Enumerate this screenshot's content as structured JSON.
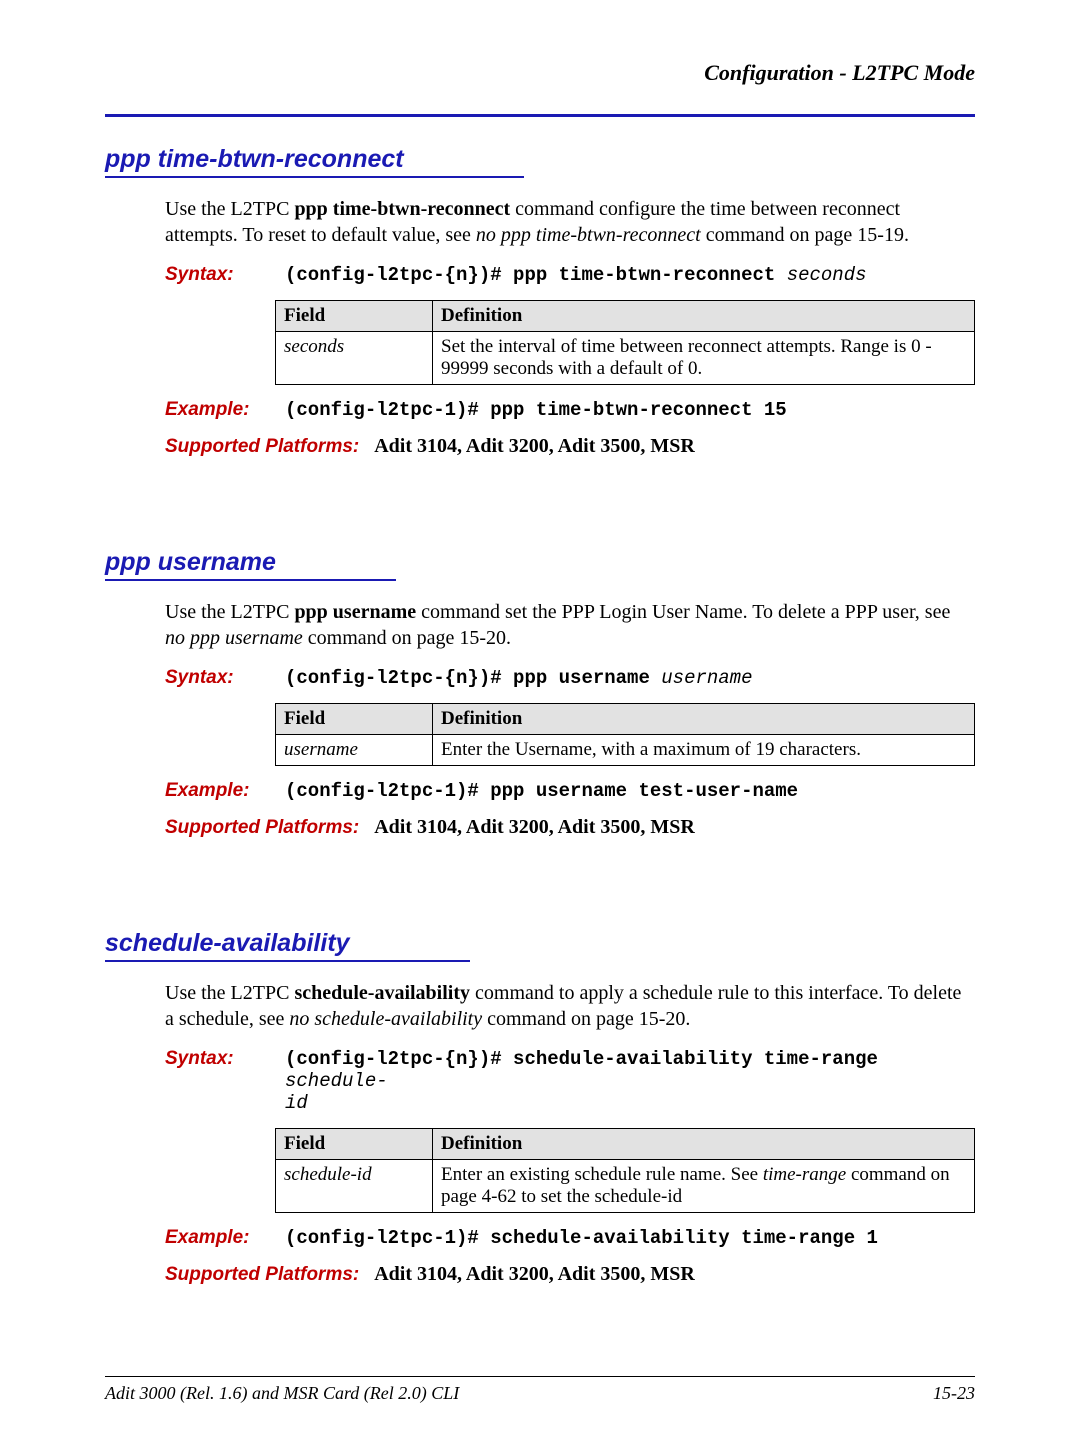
{
  "running_head": "Configuration - L2TPC Mode",
  "table_headers": {
    "field": "Field",
    "definition": "Definition"
  },
  "labels": {
    "syntax": "Syntax:",
    "example": "Example:",
    "platforms": "Supported Platforms:"
  },
  "sections": [
    {
      "title": "ppp time-btwn-reconnect",
      "intro_html": "Use the L2TPC <b>ppp time-btwn-reconnect</b> command configure the time between reconnect attempts. To reset to default value, see <i>no ppp time-btwn-reconnect</i> command on page 15-19.",
      "syntax_prefix": "(config-l2tpc-{n})# ppp time-btwn-reconnect ",
      "syntax_param": "seconds",
      "syntax_suffix": "",
      "table_row": {
        "field": "seconds",
        "definition_html": "Set the interval of time between reconnect attempts. Range is 0 - 99999 seconds with a default of 0."
      },
      "example": "(config-l2tpc-1)# ppp time-btwn-reconnect 15",
      "platforms": "Adit 3104, Adit 3200, Adit 3500, MSR"
    },
    {
      "title": "ppp username",
      "intro_html": "Use the L2TPC <b>ppp username</b> command set the PPP Login User Name. To delete a PPP user, see <i>no ppp username</i> command on page 15-20.",
      "syntax_prefix": "(config-l2tpc-{n})# ppp username ",
      "syntax_param": "username",
      "syntax_suffix": "",
      "table_row": {
        "field": "username",
        "definition_html": "Enter the Username, with a maximum of 19 characters."
      },
      "example": "(config-l2tpc-1)# ppp username test-user-name",
      "platforms": "Adit 3104, Adit 3200, Adit 3500, MSR"
    },
    {
      "title": "schedule-availability",
      "intro_html": "Use the L2TPC <b>schedule-availability</b> command to apply a schedule rule to this interface. To delete a schedule, see <i>no schedule-availability</i> command on page 15-20.",
      "syntax_prefix": "(config-l2tpc-{n})# schedule-availability time-range ",
      "syntax_param": "schedule-\nid",
      "syntax_suffix": "",
      "table_row": {
        "field": "schedule-id",
        "definition_html": "Enter an existing schedule rule name. See <i>time-range</i> command on page 4-62 to set the schedule-id"
      },
      "example": "(config-l2tpc-1)# schedule-availability time-range 1",
      "platforms": "Adit 3104, Adit 3200, Adit 3500, MSR"
    }
  ],
  "footer": {
    "left": "Adit 3000 (Rel. 1.6) and MSR Card (Rel 2.0) CLI",
    "right": "15-23"
  }
}
